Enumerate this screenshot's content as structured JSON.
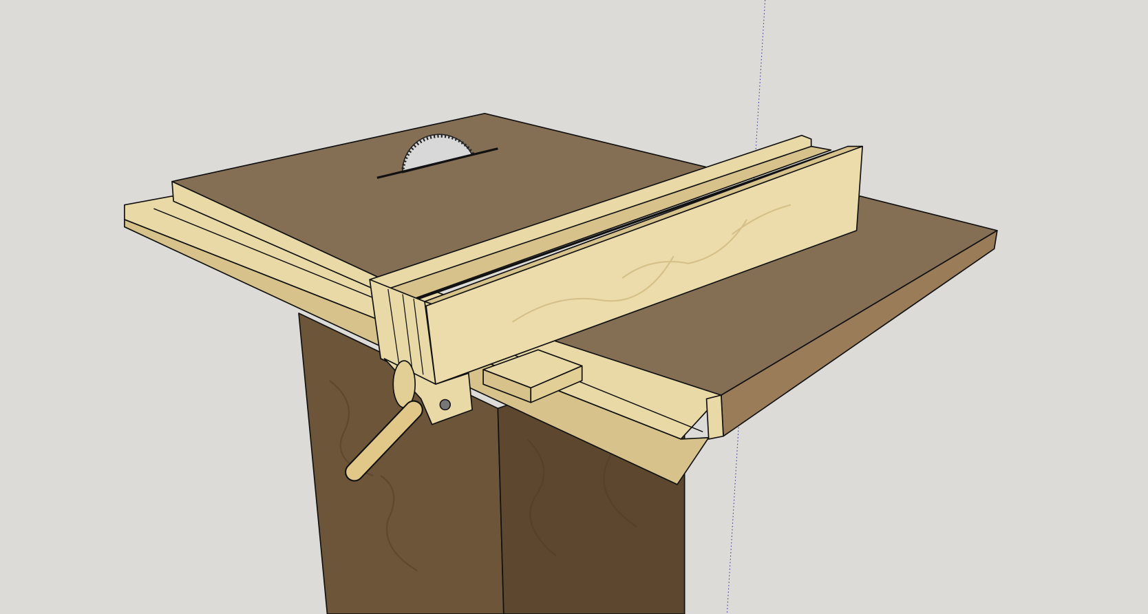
{
  "viewport": {
    "kind": "3d-model-viewport",
    "model": "table-saw-with-rip-fence"
  },
  "colors": {
    "background": "#dcdbd7",
    "table_top": "#846f55",
    "light_wood": "#e9d9a6",
    "light_wood_shade": "#d6c28a",
    "cabinet_front": "#6c5538",
    "cabinet_side": "#5d472e",
    "wing_edge": "#9a7c58",
    "blade": "#d8d8d8",
    "axis_blue": "#3a3a9a"
  }
}
